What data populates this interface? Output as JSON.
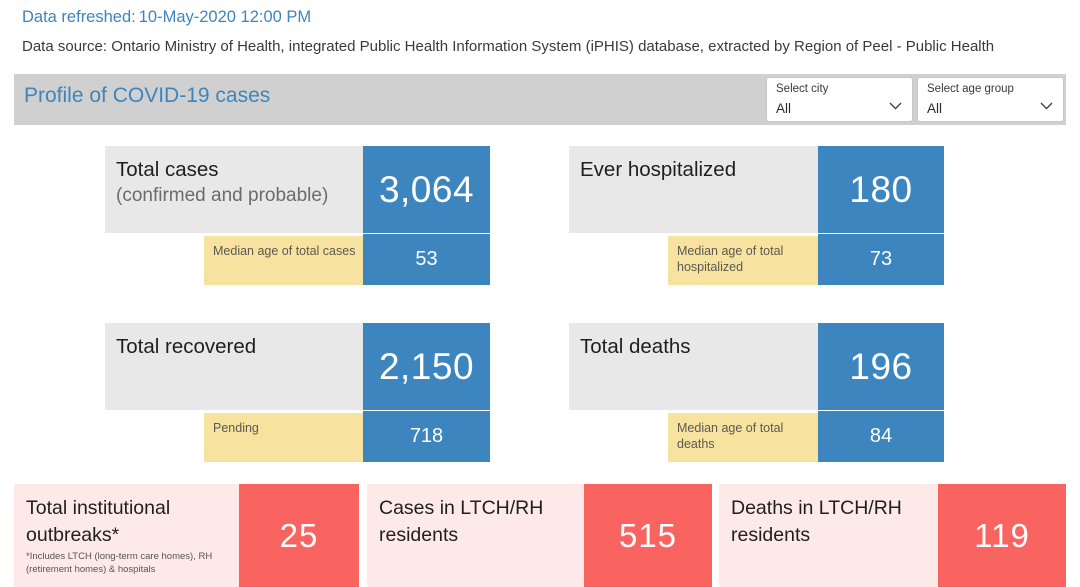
{
  "header": {
    "refresh_label": "Data refreshed:",
    "refresh_value": "10-May-2020 12:00 PM",
    "source_line": "Data source: Ontario Ministry of Health, integrated Public Health Information System (iPHIS) database, extracted by Region of Peel - Public Health"
  },
  "title_bar": {
    "title": "Profile of COVID-19 cases",
    "slicers": [
      {
        "name": "city",
        "title": "Select city",
        "value": "All",
        "icon": "chevron-down-icon"
      },
      {
        "name": "age",
        "title": "Select age group",
        "value": "All",
        "icon": "chevron-down-icon"
      }
    ]
  },
  "colors": {
    "accent_blue": "#3D85BE",
    "label_grey": "#E8E8E8",
    "sub_yellow": "#F7E2A0",
    "accent_red": "#FA6460",
    "label_pink": "#FDEAE8",
    "title_band": "#D0D0D0"
  },
  "kpi_cards": [
    {
      "name": "total-cases",
      "label_line1": "Total cases",
      "label_line2": "(confirmed and probable)",
      "value": "3,064",
      "sub_label": "Median age of total cases",
      "sub_value": "53"
    },
    {
      "name": "ever-hospitalized",
      "label_line1": "Ever hospitalized",
      "label_line2": "",
      "value": "180",
      "sub_label": "Median age of total hospitalized",
      "sub_value": "73"
    },
    {
      "name": "total-recovered",
      "label_line1": "Total recovered",
      "label_line2": "",
      "value": "2,150",
      "sub_label": "Pending",
      "sub_value": "718"
    },
    {
      "name": "total-deaths",
      "label_line1": "Total deaths",
      "label_line2": "",
      "value": "196",
      "sub_label": "Median age of total deaths",
      "sub_value": "84"
    }
  ],
  "outbreak_cards": [
    {
      "name": "total-institutional-outbreaks",
      "label": "Total institutional outbreaks*",
      "note": "*Includes LTCH (long-term care homes), RH (retirement homes) & hospitals",
      "value": "25"
    },
    {
      "name": "cases-in-ltch-rh-residents",
      "label": "Cases in LTCH/RH residents",
      "note": "",
      "value": "515"
    },
    {
      "name": "deaths-in-ltch-rh-residents",
      "label": "Deaths in LTCH/RH residents",
      "note": "",
      "value": "119"
    }
  ]
}
